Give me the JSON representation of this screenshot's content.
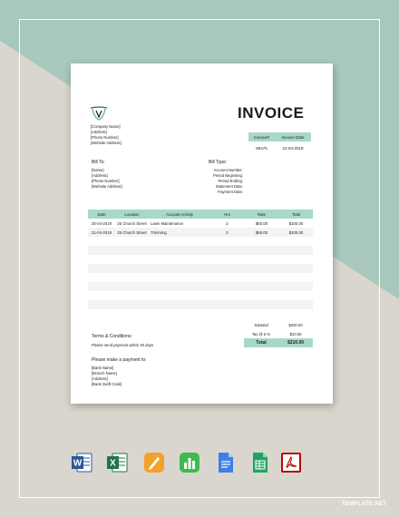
{
  "colors": {
    "accent": "#a8d8c8",
    "bg_mint": "#a9c8bd",
    "bg_beige": "#d9d6cd",
    "title": "#1a1a1a"
  },
  "document": {
    "title": "INVOICE",
    "company_lines": [
      "[Company Name]",
      "[Address]",
      "[Phone Number]",
      "[Website Address]"
    ],
    "invoice_meta": {
      "headers": [
        "Invoice#",
        "Invoice Date"
      ],
      "values": [
        "89475",
        "21-04-2019"
      ]
    },
    "bill_to": {
      "heading": "Bill To:",
      "lines": [
        "[Name]",
        "[Address]",
        "[Phone Number]",
        "[Website Address]"
      ]
    },
    "bill_type": {
      "heading": "Bill Type:",
      "lines": [
        "Account Number:",
        "Period Beginning:",
        "Period Ending:",
        "Statement Date:",
        "Payment Date:"
      ]
    },
    "table": {
      "headers": [
        "Date",
        "Location",
        "Account Activity",
        "Hrs",
        "Rate",
        "Total"
      ],
      "rows": [
        [
          "20-04-2019",
          "25 Church Street",
          "Lawn Maintenance",
          "2",
          "$50.00",
          "$100.00"
        ],
        [
          "21-04-2019",
          "25 Church Street",
          "Trimming",
          "2",
          "$50.00",
          "$100.00"
        ],
        [
          "",
          "",
          "",
          "",
          "",
          ""
        ],
        [
          "",
          "",
          "",
          "",
          "",
          ""
        ],
        [
          "",
          "",
          "",
          "",
          "",
          ""
        ],
        [
          "",
          "",
          "",
          "",
          "",
          ""
        ],
        [
          "",
          "",
          "",
          "",
          "",
          ""
        ],
        [
          "",
          "",
          "",
          "",
          "",
          ""
        ],
        [
          "",
          "",
          "",
          "",
          "",
          ""
        ],
        [
          "",
          "",
          "",
          "",
          "",
          ""
        ]
      ]
    },
    "totals": [
      {
        "label": "Subtotal",
        "value": "$200.00"
      },
      {
        "label": "Tax @ 5 %",
        "value": "$10.00"
      },
      {
        "label": "Total",
        "value": "$210.00"
      }
    ],
    "terms": {
      "heading": "Terms & Conditions:",
      "text": "Please send payment within 30 days"
    },
    "payment": {
      "heading": "Please make a payment to:",
      "lines": [
        "[Bank Name]",
        "[Branch Name]",
        "[Address]",
        "[Bank Swift Code]"
      ]
    }
  },
  "formats": [
    {
      "name": "word-icon",
      "letter": "W",
      "color": "#2b579a"
    },
    {
      "name": "excel-icon",
      "letter": "X",
      "color": "#217346"
    },
    {
      "name": "pages-icon",
      "letter": "",
      "color": "#f4a12a"
    },
    {
      "name": "numbers-icon",
      "letter": "",
      "color": "#3dbb4f"
    },
    {
      "name": "google-docs-icon",
      "letter": "",
      "color": "#3d7fe6"
    },
    {
      "name": "google-sheets-icon",
      "letter": "",
      "color": "#20a464"
    },
    {
      "name": "pdf-icon",
      "letter": "",
      "color": "#b30b00"
    }
  ],
  "brand": "TEMPLATE.NET"
}
